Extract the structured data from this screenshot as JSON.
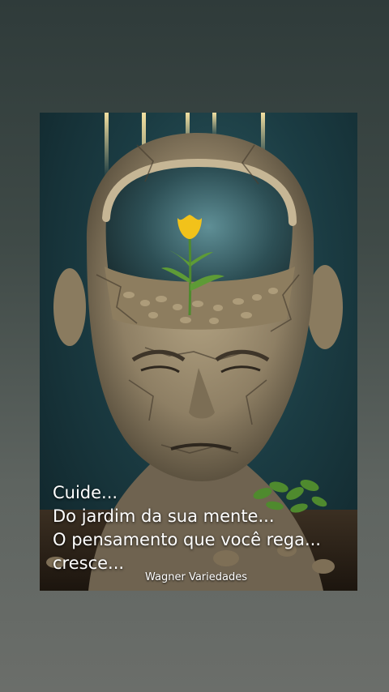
{
  "post": {
    "caption_lines": [
      "Cuide...",
      "Do jardim da sua mente...",
      "O pensamento que você rega...",
      "cresce..."
    ],
    "signature": "Wagner Variedades"
  },
  "colors": {
    "page_top": "#2f3b3a",
    "page_bottom": "#6b6e6a",
    "stone": "#a8977a",
    "flower": "#f2c21a",
    "leaf": "#5e9b36"
  }
}
